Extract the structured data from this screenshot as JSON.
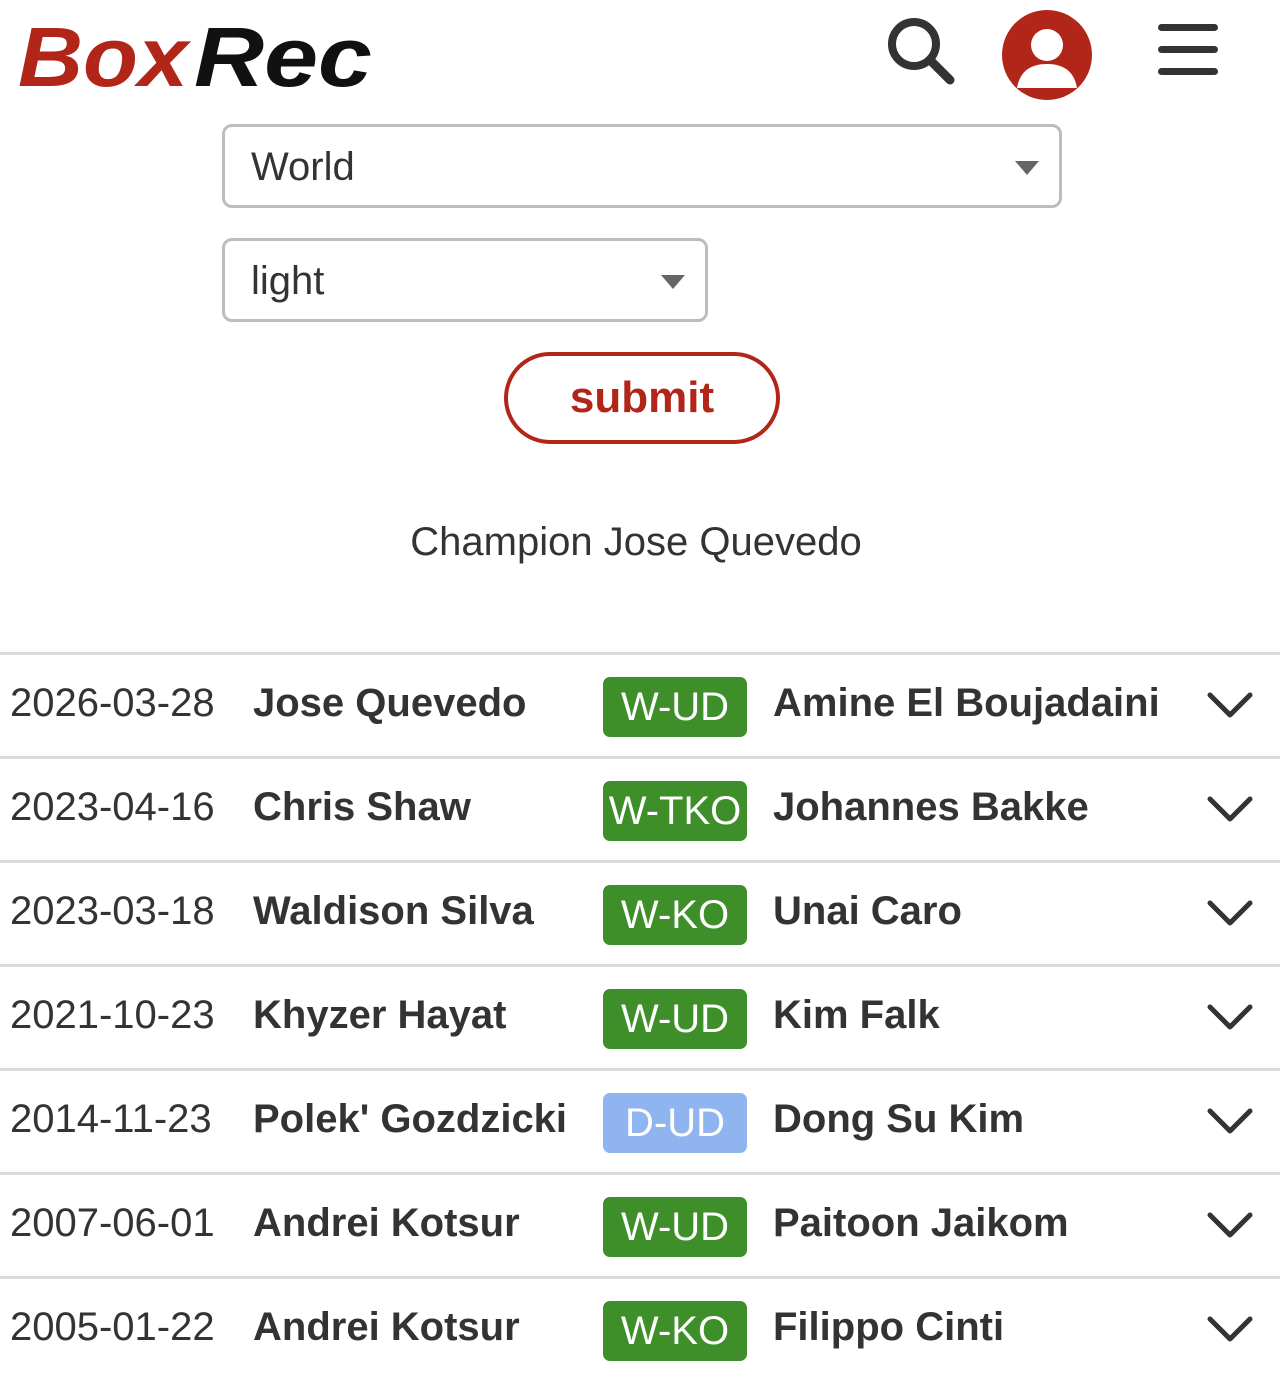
{
  "header": {
    "logo_text": "BoxRec",
    "logo_colors": {
      "box": "#b22519",
      "rec": "#111111"
    },
    "icons": [
      "search-icon",
      "user-icon",
      "menu-icon"
    ]
  },
  "filters": {
    "region": "World",
    "weight": "light",
    "submit_label": "submit"
  },
  "champion_text": "Champion Jose Quevedo",
  "colors": {
    "brand_red": "#b22519",
    "win": "#3e8e2a",
    "draw": "#8fb4f0"
  },
  "fights": [
    {
      "date": "2026-03-28",
      "fighter1": "Jose Quevedo",
      "result": "W-UD",
      "result_type": "win",
      "fighter2": "Amine El Boujadaini"
    },
    {
      "date": "2023-04-16",
      "fighter1": "Chris Shaw",
      "result": "W-TKO",
      "result_type": "win",
      "fighter2": "Johannes Bakke"
    },
    {
      "date": "2023-03-18",
      "fighter1": "Waldison Silva",
      "result": "W-KO",
      "result_type": "win",
      "fighter2": "Unai Caro"
    },
    {
      "date": "2021-10-23",
      "fighter1": "Khyzer Hayat",
      "result": "W-UD",
      "result_type": "win",
      "fighter2": "Kim Falk"
    },
    {
      "date": "2014-11-23",
      "fighter1": "Polek' Gozdzicki",
      "result": "D-UD",
      "result_type": "draw",
      "fighter2": "Dong Su Kim"
    },
    {
      "date": "2007-06-01",
      "fighter1": "Andrei Kotsur",
      "result": "W-UD",
      "result_type": "win",
      "fighter2": "Paitoon Jaikom"
    },
    {
      "date": "2005-01-22",
      "fighter1": "Andrei Kotsur",
      "result": "W-KO",
      "result_type": "win",
      "fighter2": "Filippo Cinti"
    }
  ]
}
